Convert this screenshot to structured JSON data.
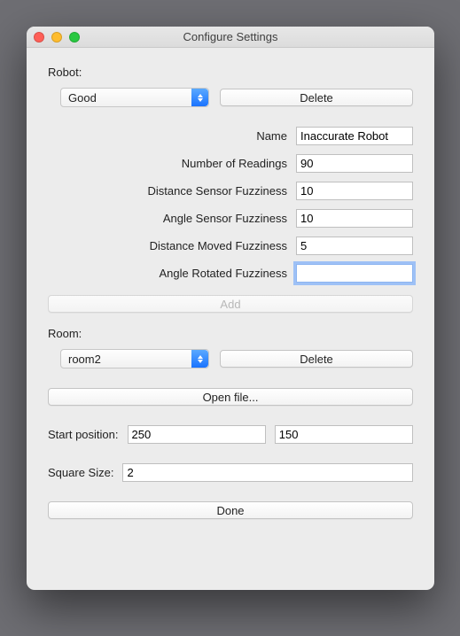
{
  "window": {
    "title": "Configure Settings"
  },
  "robot": {
    "label": "Robot:",
    "select_value": "Good",
    "delete_label": "Delete",
    "fields": {
      "name": {
        "label": "Name",
        "value": "Inaccurate Robot"
      },
      "readings": {
        "label": "Number of Readings",
        "value": "90"
      },
      "dist_sensor": {
        "label": "Distance Sensor Fuzziness",
        "value": "10"
      },
      "angle_sensor": {
        "label": "Angle Sensor Fuzziness",
        "value": "10"
      },
      "dist_moved": {
        "label": "Distance Moved Fuzziness",
        "value": "5"
      },
      "angle_rot": {
        "label": "Angle Rotated Fuzziness",
        "value": ""
      }
    },
    "add_label": "Add"
  },
  "room": {
    "label": "Room:",
    "select_value": "room2",
    "delete_label": "Delete",
    "open_label": "Open file..."
  },
  "start": {
    "label": "Start position:",
    "x": "250",
    "y": "150"
  },
  "square": {
    "label": "Square Size:",
    "value": "2"
  },
  "done_label": "Done"
}
